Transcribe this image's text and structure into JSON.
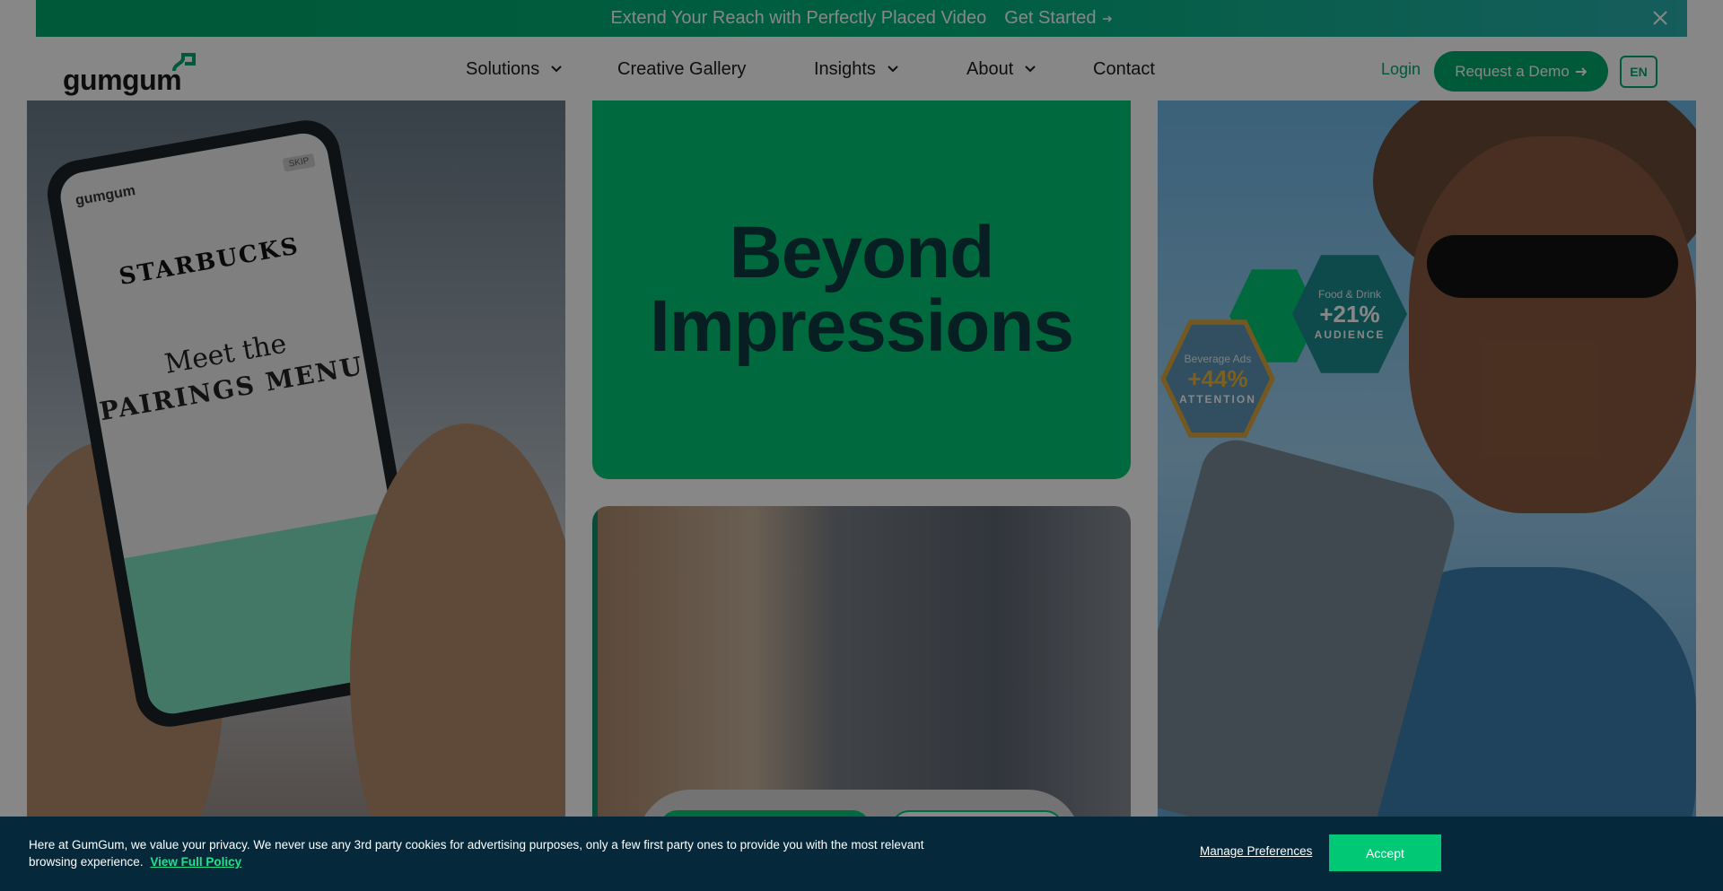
{
  "promo": {
    "text": "Extend Your Reach with Perfectly Placed Video",
    "cta": "Get Started",
    "cta_icon": "arrow-right-icon",
    "close_icon": "close-icon"
  },
  "nav": {
    "logo": "gumgum",
    "items": [
      {
        "label": "Solutions",
        "has_dropdown": true
      },
      {
        "label": "Creative Gallery",
        "has_dropdown": false
      },
      {
        "label": "Insights",
        "has_dropdown": true
      },
      {
        "label": "About",
        "has_dropdown": true
      },
      {
        "label": "Contact",
        "has_dropdown": false
      }
    ],
    "login": "Login",
    "demo": "Request a Demo",
    "lang": "EN"
  },
  "hero": {
    "title_line1": "Beyond",
    "title_line2": "Impressions"
  },
  "left_panel": {
    "phone_logo": "gumgum",
    "skip": "SKIP",
    "brand": "STARBUCKS",
    "tagline_top": "Meet the",
    "tagline_bottom": "PAIRINGS MENU"
  },
  "right_panel": {
    "stat_teal": {
      "category": "Food & Drink",
      "value": "+21%",
      "label": "AUDIENCE"
    },
    "stat_gold": {
      "category": "Beverage Ads",
      "value": "+44%",
      "label": "ATTENTION"
    }
  },
  "cookie": {
    "text": "Here at GumGum, we value your privacy. We never use any 3rd party cookies for advertising purposes, only a few first party ones to provide you with the most relevant browsing experience.",
    "policy_link": "View Full Policy",
    "manage": "Manage Preferences",
    "accept": "Accept"
  },
  "colors": {
    "brand_green": "#00c875",
    "nav_green": "#00a86b",
    "cookie_bg": "#05293a",
    "hero_text": "#0f3a40"
  }
}
